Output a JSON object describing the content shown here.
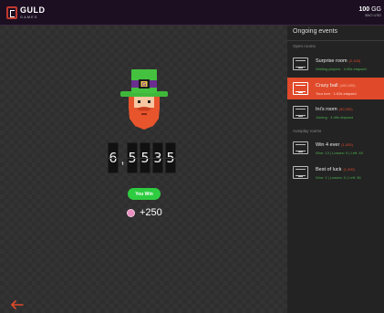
{
  "header": {
    "logo_name": "GULD",
    "logo_sub": "GAMES",
    "balance_amount": "100",
    "balance_currency": "GG",
    "balance_sub": "$NO USD"
  },
  "game": {
    "counter_digits": [
      "6",
      "5",
      "5",
      "3",
      "5"
    ],
    "counter_separator": ",",
    "win_label": "You Win",
    "reward": "+250",
    "hat_letter": "G"
  },
  "sidebar": {
    "title": "Ongoing events",
    "sections": [
      {
        "label": "Open rooms",
        "rooms": [
          {
            "name": "Surprise room",
            "tag": "(2,100)",
            "sub": "Waiting players · 4:45s elapsed",
            "active": false
          },
          {
            "name": "Crazy ball",
            "tag": "(400,000)",
            "sub": "Your turn · 1:02s elapsed",
            "active": true
          },
          {
            "name": "Ini's room",
            "tag": "(50,000)",
            "sub": "Joining · 4:49s elapsed",
            "active": false
          }
        ]
      },
      {
        "label": "Autoplay rooms",
        "rooms": [
          {
            "name": "Win 4 ever",
            "tag": "(1,000)",
            "sub": "Won: 13 | Losses: 0 | Left: 45",
            "active": false
          },
          {
            "name": "Best of luck",
            "tag": "(1,000)",
            "sub": "Won: 2 | Losses: 0 | Left: 36",
            "active": false
          }
        ]
      }
    ]
  },
  "colors": {
    "accent": "#e04a2a",
    "win_green": "#2ecc40",
    "header_bg": "#1c0f22"
  },
  "icons": {
    "back": "arrow-left-icon",
    "chip": "chip-icon",
    "room": "slot-machine-icon"
  }
}
